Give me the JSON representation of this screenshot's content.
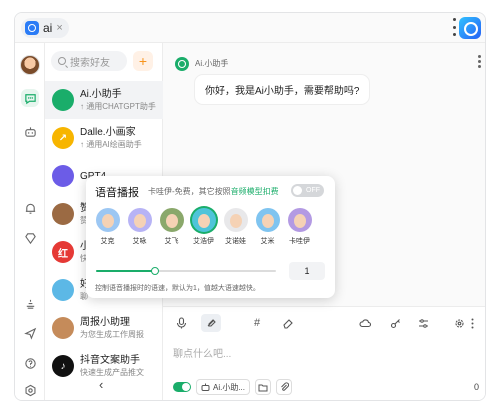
{
  "tab": {
    "label": "ai",
    "close": "×"
  },
  "sidebar": {
    "collapse_icon": "‹",
    "search_placeholder": "搜索好友",
    "add_label": "+",
    "contacts": [
      {
        "name": "Ai.小助手",
        "sub": "↑ 通用CHATGPT助手",
        "avatar_color": "#1aad6a",
        "avatar_text": ""
      },
      {
        "name": "Dalle.小画家",
        "sub": "↑ 通用AI绘画助手",
        "avatar_color": "#f7b500",
        "avatar_text": "↗"
      },
      {
        "name": "GPT4",
        "sub": "",
        "avatar_color": "#6c5ce7",
        "avatar_text": ""
      },
      {
        "name": "赞",
        "sub": "赞",
        "avatar_color": "#9b6a43",
        "avatar_text": ""
      },
      {
        "name": "小",
        "sub": "快",
        "avatar_color": "#e53935",
        "avatar_text": "红"
      },
      {
        "name": "好",
        "sub": "聊",
        "avatar_color": "#5cb8e6",
        "avatar_text": ""
      },
      {
        "name": "周报小助理",
        "sub": "为您生成工作周报",
        "avatar_color": "#c58b5a",
        "avatar_text": ""
      },
      {
        "name": "抖音文案助手",
        "sub": "快速生成产品推文",
        "avatar_color": "#111111",
        "avatar_text": "♪"
      }
    ]
  },
  "chat": {
    "bot_name": "Ai.小助手",
    "greeting": "你好，我是Ai小助手，需要帮助吗?",
    "input_placeholder": "聊点什么吧...",
    "model_pill": "Ai.小助...",
    "char_count": "0"
  },
  "voice_popup": {
    "title": "语音播报",
    "hint_prefix": "卡哇伊-免费，其它按照",
    "hint_link": "音频模型扣费",
    "toggle_label": "OFF",
    "voices": [
      {
        "name": "艾克",
        "bg": "#9cc7f3"
      },
      {
        "name": "艾咏",
        "bg": "#b7b3f5"
      },
      {
        "name": "艾飞",
        "bg": "#8aa86b"
      },
      {
        "name": "艾浩伊",
        "bg": "#4ec4d9"
      },
      {
        "name": "艾诺娃",
        "bg": "#e8e8ea"
      },
      {
        "name": "艾米",
        "bg": "#7fc4f0"
      },
      {
        "name": "卡哇伊",
        "bg": "#b39ae3"
      }
    ],
    "selected_voice": "艾浩伊",
    "speed_fraction": 0.33,
    "speed_value": "1",
    "description": "控制语音播报时的语速，默认为1，值越大语速越快。"
  },
  "colors": {
    "accent": "#1aad6a",
    "warning": "#f7941d"
  },
  "icons": {
    "rail": [
      "avatar",
      "chat-icon",
      "robot-icon",
      "bell-icon",
      "diamond-icon",
      "lamp-icon",
      "send-icon",
      "help-icon",
      "settings-icon"
    ],
    "toolbar": [
      "mic-icon",
      "voice-broadcast-icon",
      "hashtag-icon",
      "eraser-icon",
      "cloud-icon",
      "key-icon",
      "sliders-icon",
      "gear-icon",
      "more-icon"
    ]
  }
}
